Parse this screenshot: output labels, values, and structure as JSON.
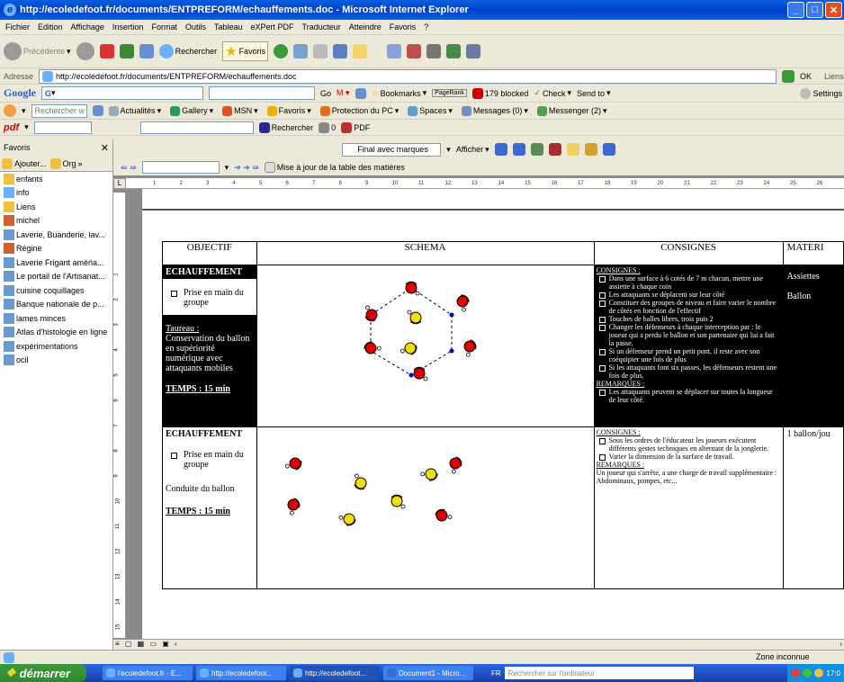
{
  "window": {
    "title": "http://ecoledefoot.fr/documents/ENTPREFORM/echauffements.doc - Microsoft Internet Explorer"
  },
  "menu": [
    "Fichier",
    "Edition",
    "Affichage",
    "Insertion",
    "Format",
    "Outils",
    "Tableau",
    "eXPert PDF",
    "Traducteur",
    "Atteindre",
    "Favoris",
    "?"
  ],
  "toolbar": {
    "back_label": "Précédente",
    "search_label": "Rechercher",
    "favorites_label": "Favoris"
  },
  "address": {
    "label": "Adresse",
    "url": "http://ecoledefoot.fr/documents/ENTPREFORM/echauffements.doc",
    "ok_label": "OK",
    "links_label": "Liens"
  },
  "google_bar": {
    "go_label": "Go",
    "bookmarks_label": "Bookmarks",
    "pagerank_label": "PageRank",
    "blocked_label": "179 blocked",
    "check_label": "Check",
    "sendto_label": "Send to",
    "settings_label": "Settings"
  },
  "msn_bar": {
    "search_placeholder": "Rechercher w",
    "items": [
      "Actualités",
      "Gallery",
      "MSN",
      "Favoris",
      "Protection du PC",
      "Spaces",
      "Messages (0)",
      "Messenger (2)"
    ]
  },
  "pdf_bar": {
    "label": "pdf",
    "search_label": "Rechercher",
    "count": "0",
    "pdf_label": "PDF"
  },
  "word_toolbar": {
    "display_mode": "Final avec marques",
    "show_label": "Afficher",
    "toc_label": "Mise à jour de la table des matières"
  },
  "favorites": {
    "title": "Favoris",
    "add_label": "Ajouter...",
    "org_label": "Org",
    "items": [
      "enfants",
      "info",
      "Liens",
      "michel",
      "Laverie, Buanderie, lav...",
      "Régine",
      "Laverie Frigant  améńa...",
      "Le portail de l'Artisanat...",
      "cuisine coquillages",
      "Banque nationale de p...",
      "lames minces",
      "Atlas d'histologie en ligne",
      "expérimentations",
      "ocil"
    ]
  },
  "ruler": {
    "marks": [
      "1",
      "2",
      "3",
      "4",
      "5",
      "6",
      "7",
      "8",
      "9",
      "10",
      "11",
      "12",
      "13",
      "14",
      "15",
      "16",
      "17",
      "18",
      "19",
      "20",
      "21",
      "22",
      "23",
      "24",
      "25",
      "26"
    ]
  },
  "vruler": {
    "marks": [
      "1",
      "2",
      "3",
      "4",
      "5",
      "6",
      "7",
      "8",
      "9",
      "10",
      "11",
      "12",
      "13",
      "14",
      "15"
    ]
  },
  "table": {
    "headers": [
      "OBJECTIF",
      "SCHEMA",
      "CONSIGNES",
      "MATERI"
    ],
    "row1": {
      "title": "ECHAUFFEMENT",
      "bullet": "Prise en main du groupe",
      "subtitle": "Taureau :",
      "desc": "Conservation du ballon en supériorité numérique avec attaquants mobiles",
      "time": "TEMPS : 15 min",
      "consignes_title": "CONSIGNES :",
      "consignes": [
        "Dans une surface à 6 cotés de 7 m chacun, mettre une assiette à chaque coin",
        "Les attaquants se déplacent sur leur côté",
        "Constituer des groupes de niveau et faire varier le nombre de côtés en fonction de l'effectif",
        "Touches de balles libres, trois puis 2",
        "Changer les défenseurs à chaque interception par : le joueur qui a perdu le ballon et son partenaire qui lui a fait la passe.",
        "Si un défenseur prend un petit pont, il reste avec son coéquipier une fois de plus",
        "Si les attaquants font six passes, les défenseurs restent une fois de plus."
      ],
      "remarques_title": "REMARQUES :",
      "remarques": [
        "Les attaquants peuvent se déplacer sur toutes la longueur de leur côté."
      ],
      "materiel": [
        "Assiettes",
        "Ballon"
      ]
    },
    "row2": {
      "title": "ECHAUFFEMENT",
      "bullet": "Prise en main du groupe",
      "subtitle": "Conduite du ballon",
      "time": "TEMPS : 15 min",
      "consignes_title": "CONSIGNES :",
      "consignes": [
        "Sous les ordres de l'éducateur les joueurs exécutent différents gestes techniques en alternant de la jonglerie.",
        "Varier la dimension de la surface de travail."
      ],
      "remarques_title": "REMARQUES :",
      "remarques_text": "Un joueur qui s'arrête, a une charge de travail supplémentaire : Abdominaux, pompes, etc...",
      "materiel": [
        "1 ballon/jou"
      ]
    }
  },
  "status": {
    "zone": "Zone inconnue"
  },
  "taskbar": {
    "start": "démarrer",
    "tasks": [
      "l'ecoledefoot.fr - E...",
      "http://ecoledefoot...",
      "http://ecoledefoot...",
      "Document1 - Micro..."
    ],
    "lang": "FR",
    "search_placeholder": "Rechercher sur l'ordinateur",
    "clock": "17:0"
  },
  "colors": {
    "title_blue": "#0a5ee0",
    "player_red": "#e00000",
    "player_yellow": "#f0e000",
    "cone_blue": "#0000cc"
  }
}
